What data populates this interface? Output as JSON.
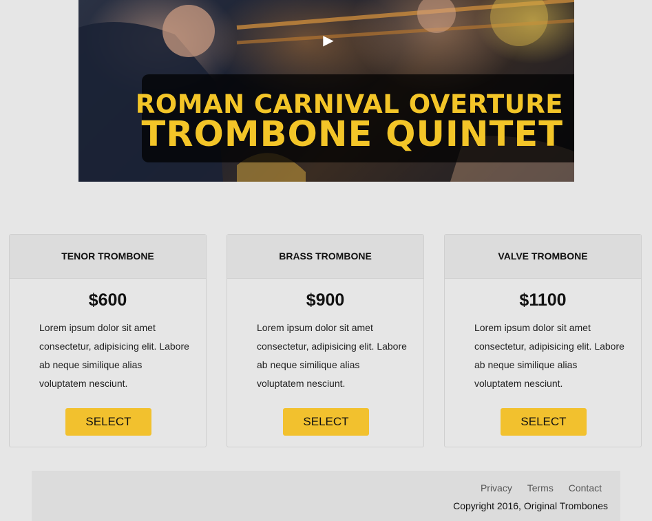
{
  "video": {
    "title_line1": "ROMAN CARNIVAL OVERTURE",
    "title_line2": "TROMBONE QUINTET",
    "play_icon": "▶",
    "accent_color": "#f3c528"
  },
  "pricing": {
    "cards": [
      {
        "name": "TENOR TROMBONE",
        "price": "$600",
        "description": "Lorem ipsum dolor sit amet consectetur, adipisicing elit. Labore ab neque similique alias voluptatem nesciunt.",
        "button_label": "SELECT"
      },
      {
        "name": "BRASS TROMBONE",
        "price": "$900",
        "description": "Lorem ipsum dolor sit amet consectetur, adipisicing elit. Labore ab neque similique alias voluptatem nesciunt.",
        "button_label": "SELECT"
      },
      {
        "name": "VALVE TROMBONE",
        "price": "$1100",
        "description": "Lorem ipsum dolor sit amet consectetur, adipisicing elit. Labore ab neque similique alias voluptatem nesciunt.",
        "button_label": "SELECT"
      }
    ],
    "button_color": "#f2c12e"
  },
  "footer": {
    "links": [
      "Privacy",
      "Terms",
      "Contact"
    ],
    "copyright": "Copyright 2016, Original Trombones"
  }
}
